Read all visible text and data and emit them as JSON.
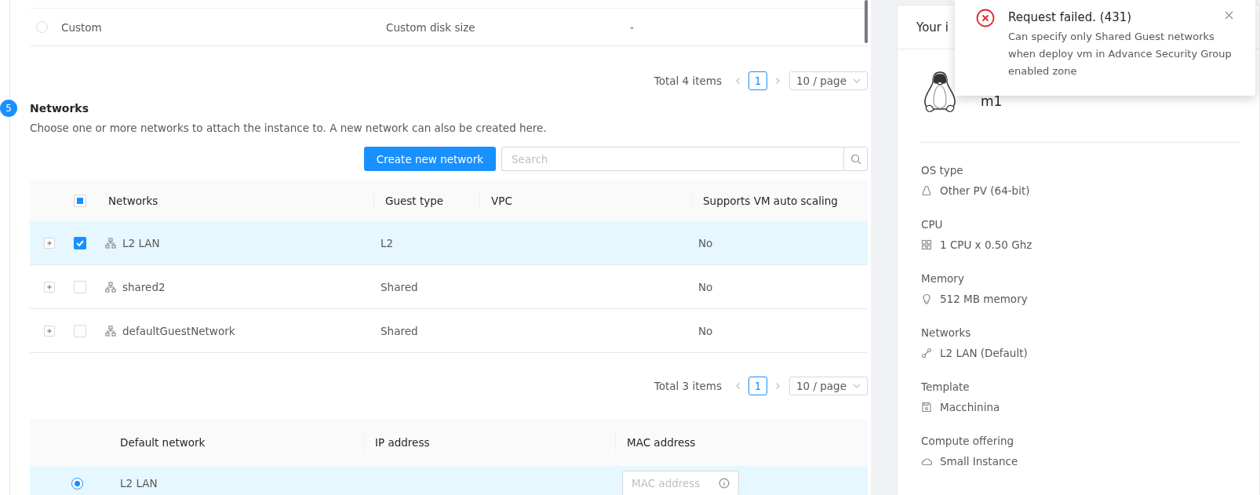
{
  "disk_table": {
    "rows": [
      {
        "selected": false,
        "name": "Custom",
        "description": "Custom disk size",
        "column_3": "-"
      }
    ],
    "pagination": {
      "total": "Total 4 items",
      "page": "1",
      "page_size": "10 / page"
    }
  },
  "networks_step": {
    "number": "5",
    "title": "Networks",
    "description": "Choose one or more networks to attach the instance to. A new network can also be created here.",
    "create_button": "Create new network",
    "search": {
      "placeholder": "Search"
    },
    "table": {
      "indeterminate": true,
      "columns": [
        "Networks",
        "Guest type",
        "VPC",
        "Supports VM auto scaling"
      ],
      "rows": [
        {
          "checked": true,
          "name": "L2 LAN",
          "guest_type": "L2",
          "autoscaling": "No"
        },
        {
          "checked": false,
          "name": "shared2",
          "guest_type": "Shared",
          "autoscaling": "No"
        },
        {
          "checked": false,
          "name": "defaultGuestNetwork",
          "guest_type": "Shared",
          "autoscaling": "No"
        }
      ]
    },
    "pagination": {
      "total": "Total 3 items",
      "page": "1",
      "page_size": "10 / page"
    },
    "default_table": {
      "columns": [
        "Default network",
        "IP address",
        "MAC address"
      ],
      "rows": [
        {
          "selected": true,
          "network": "L2 LAN",
          "mac_placeholder": "MAC address"
        }
      ]
    }
  },
  "summary": {
    "title": "Your i",
    "name": "m1",
    "sections": [
      {
        "label": "OS type",
        "value": "Other PV (64-bit)"
      },
      {
        "label": "CPU",
        "value": "1 CPU x 0.50 Ghz"
      },
      {
        "label": "Memory",
        "value": "512 MB memory"
      },
      {
        "label": "Networks",
        "value": "L2 LAN (Default)"
      },
      {
        "label": "Template",
        "value": "Macchinina"
      },
      {
        "label": "Compute offering",
        "value": "Small Instance"
      }
    ]
  },
  "toast": {
    "kind": "error",
    "title": "Request failed. (431)",
    "message": "Can specify only Shared Guest networks when deploy vm in Advance Security Group enabled zone"
  }
}
